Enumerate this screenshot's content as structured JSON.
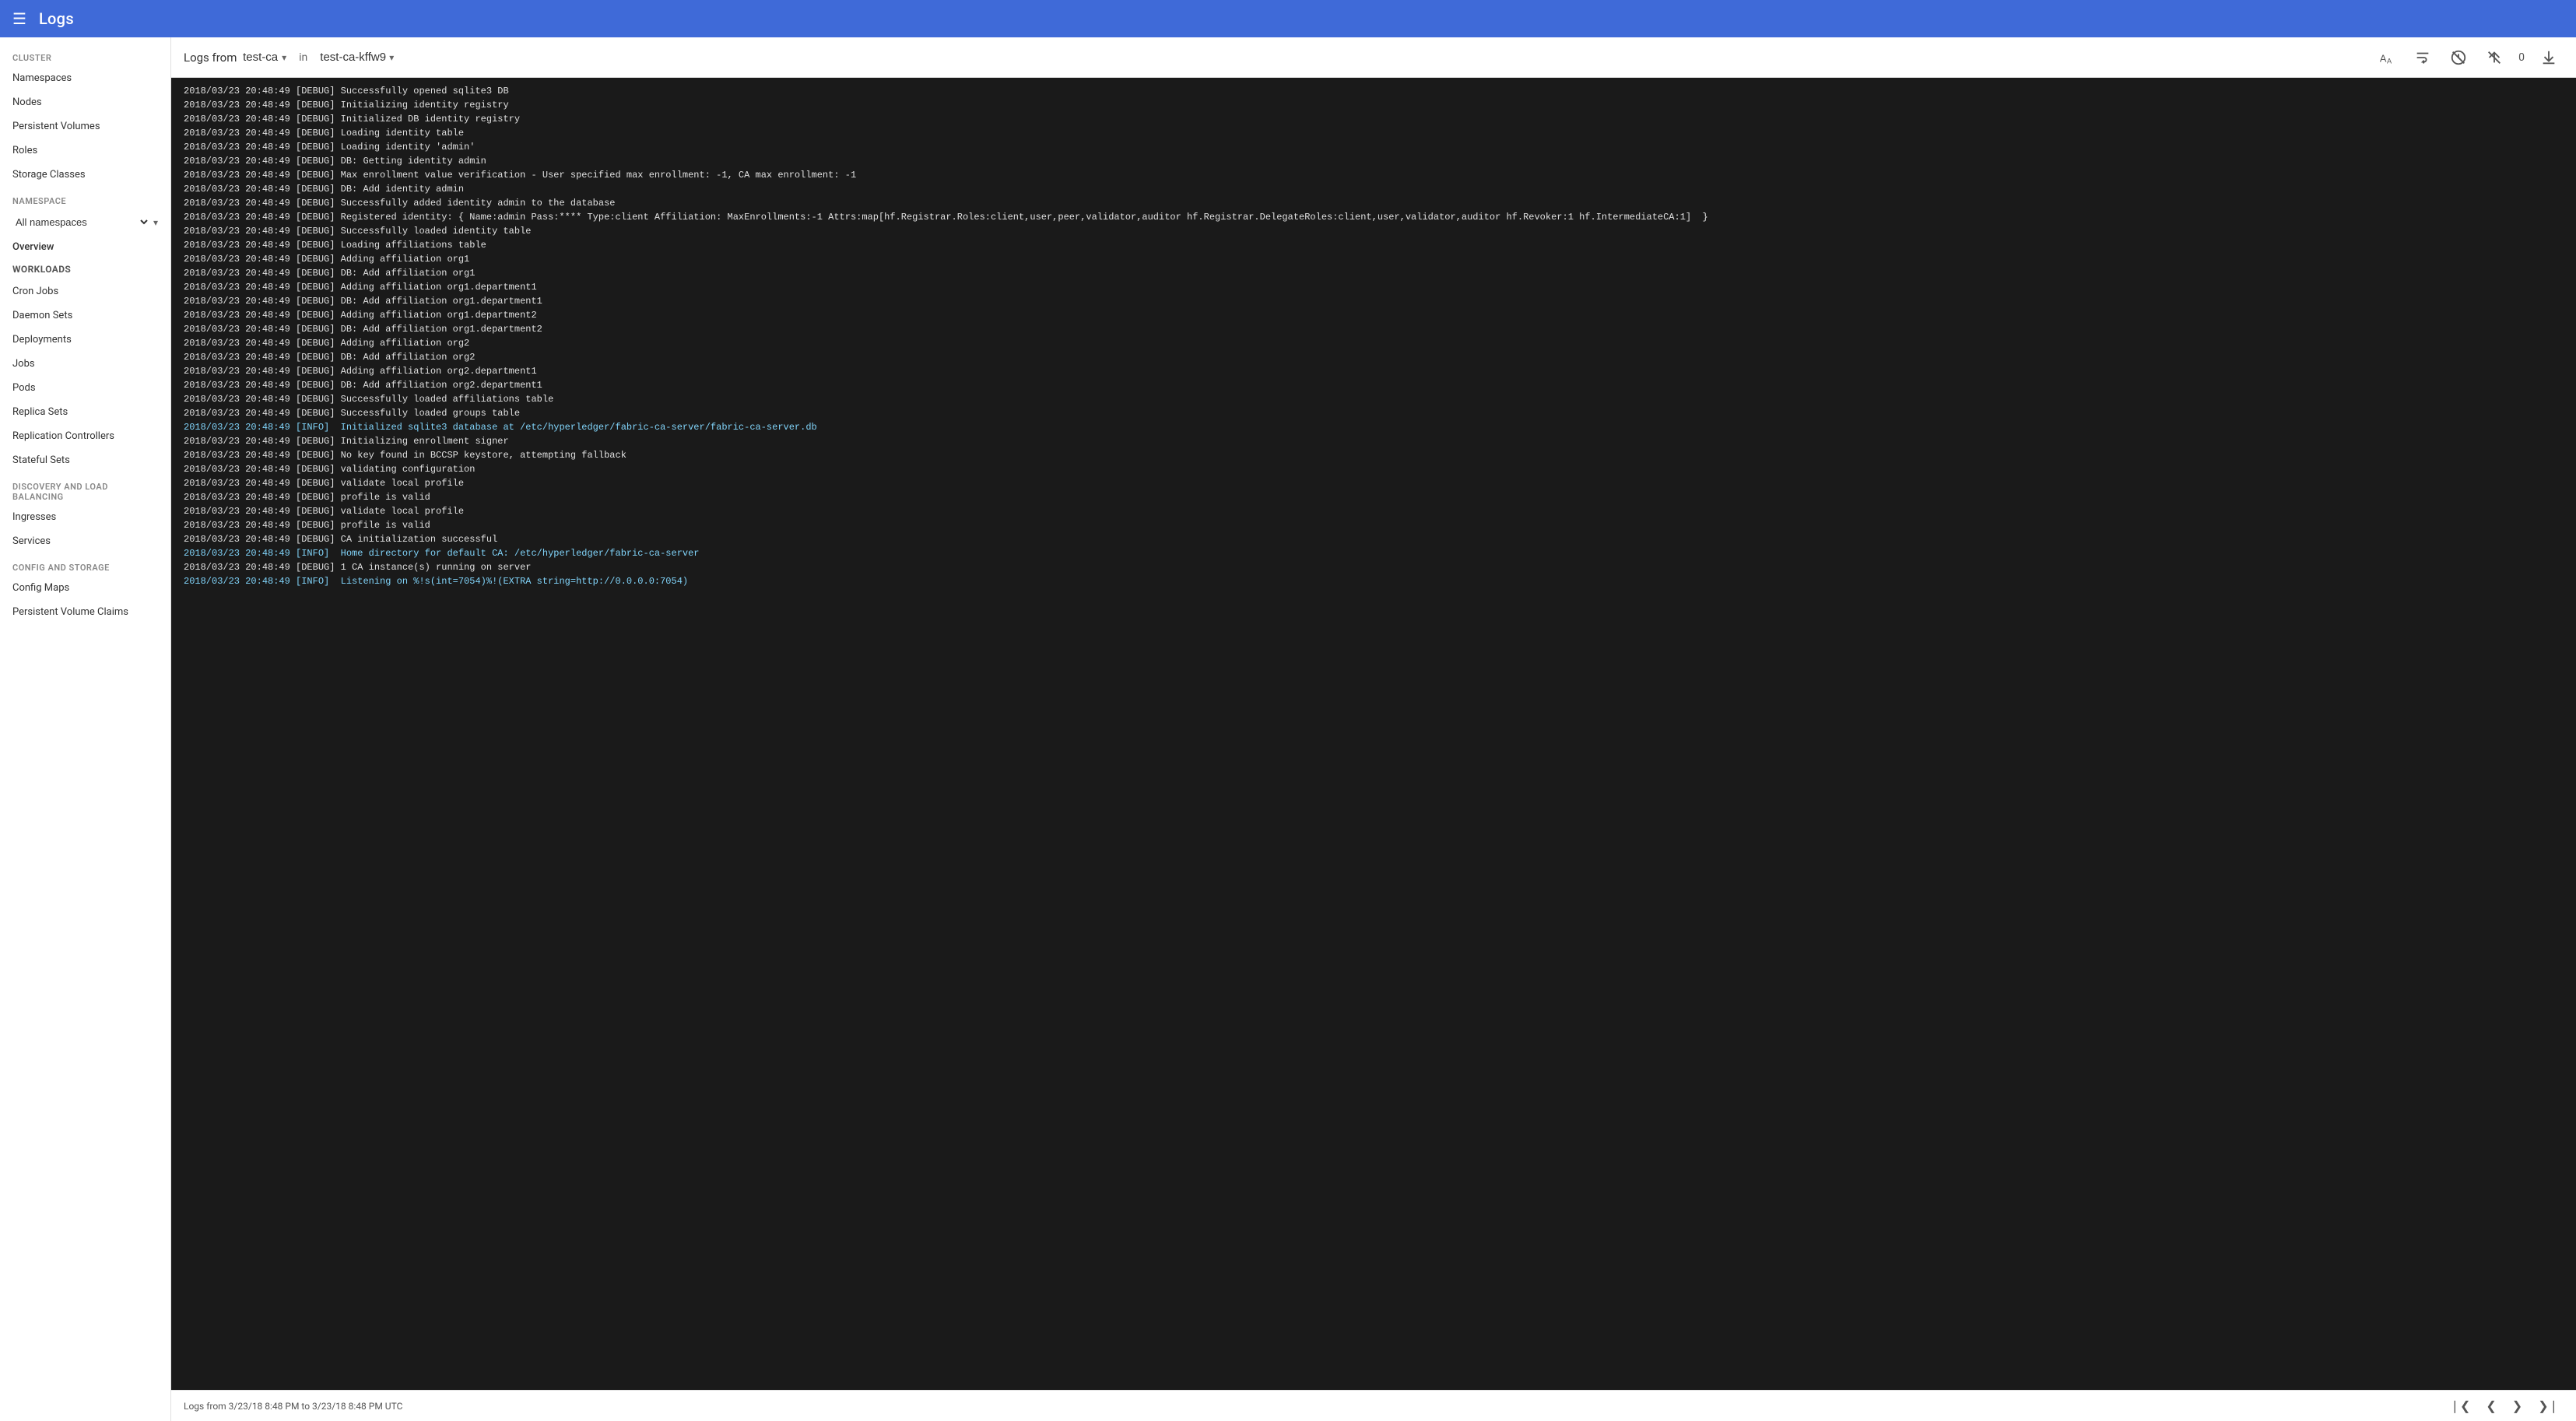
{
  "topbar": {
    "title": "Logs",
    "menu_label": "☰"
  },
  "sidebar": {
    "cluster_label": "Cluster",
    "items_cluster": [
      {
        "label": "Namespaces",
        "id": "namespaces"
      },
      {
        "label": "Nodes",
        "id": "nodes"
      },
      {
        "label": "Persistent Volumes",
        "id": "persistent-volumes"
      },
      {
        "label": "Roles",
        "id": "roles"
      },
      {
        "label": "Storage Classes",
        "id": "storage-classes"
      }
    ],
    "namespace_label": "Namespace",
    "namespace_value": "All namespaces",
    "overview_label": "Overview",
    "workloads_label": "Workloads",
    "items_workloads": [
      {
        "label": "Cron Jobs",
        "id": "cron-jobs"
      },
      {
        "label": "Daemon Sets",
        "id": "daemon-sets"
      },
      {
        "label": "Deployments",
        "id": "deployments"
      },
      {
        "label": "Jobs",
        "id": "jobs"
      },
      {
        "label": "Pods",
        "id": "pods"
      },
      {
        "label": "Replica Sets",
        "id": "replica-sets"
      },
      {
        "label": "Replication Controllers",
        "id": "replication-controllers"
      },
      {
        "label": "Stateful Sets",
        "id": "stateful-sets"
      }
    ],
    "discovery_label": "Discovery and Load Balancing",
    "items_discovery": [
      {
        "label": "Ingresses",
        "id": "ingresses"
      },
      {
        "label": "Services",
        "id": "services"
      }
    ],
    "config_label": "Config and Storage",
    "items_config": [
      {
        "label": "Config Maps",
        "id": "config-maps"
      },
      {
        "label": "Persistent Volume Claims",
        "id": "pvc"
      }
    ]
  },
  "log_viewer": {
    "source_label": "Logs from test-ca",
    "source_dropdown": "test-ca",
    "container_prefix": "in",
    "container_label": "test-ca-kffw9",
    "container_dropdown": "test-ca-kffw9",
    "toolbar_count": "0",
    "footer_range": "Logs from 3/23/18 8:48 PM to 3/23/18 8:48 PM UTC",
    "log_lines": [
      "2018/03/23 20:48:49 [DEBUG] Successfully opened sqlite3 DB",
      "2018/03/23 20:48:49 [DEBUG] Initializing identity registry",
      "2018/03/23 20:48:49 [DEBUG] Initialized DB identity registry",
      "2018/03/23 20:48:49 [DEBUG] Loading identity table",
      "2018/03/23 20:48:49 [DEBUG] Loading identity 'admin'",
      "2018/03/23 20:48:49 [DEBUG] DB: Getting identity admin",
      "2018/03/23 20:48:49 [DEBUG] Max enrollment value verification - User specified max enrollment: -1, CA max enrollment: -1",
      "2018/03/23 20:48:49 [DEBUG] DB: Add identity admin",
      "2018/03/23 20:48:49 [DEBUG] Successfully added identity admin to the database",
      "2018/03/23 20:48:49 [DEBUG] Registered identity: { Name:admin Pass:**** Type:client Affiliation: MaxEnrollments:-1 Attrs:map[hf.Registrar.Roles:client,user,peer,validator,auditor hf.Registrar.DelegateRoles:client,user,validator,auditor hf.Revoker:1 hf.IntermediateCA:1]  }",
      "2018/03/23 20:48:49 [DEBUG] Successfully loaded identity table",
      "2018/03/23 20:48:49 [DEBUG] Loading affiliations table",
      "2018/03/23 20:48:49 [DEBUG] Adding affiliation org1",
      "2018/03/23 20:48:49 [DEBUG] DB: Add affiliation org1",
      "2018/03/23 20:48:49 [DEBUG] Adding affiliation org1.department1",
      "2018/03/23 20:48:49 [DEBUG] DB: Add affiliation org1.department1",
      "2018/03/23 20:48:49 [DEBUG] Adding affiliation org1.department2",
      "2018/03/23 20:48:49 [DEBUG] DB: Add affiliation org1.department2",
      "2018/03/23 20:48:49 [DEBUG] Adding affiliation org2",
      "2018/03/23 20:48:49 [DEBUG] DB: Add affiliation org2",
      "2018/03/23 20:48:49 [DEBUG] Adding affiliation org2.department1",
      "2018/03/23 20:48:49 [DEBUG] DB: Add affiliation org2.department1",
      "2018/03/23 20:48:49 [DEBUG] Successfully loaded affiliations table",
      "2018/03/23 20:48:49 [DEBUG] Successfully loaded groups table",
      "2018/03/23 20:48:49 [INFO]  Initialized sqlite3 database at /etc/hyperledger/fabric-ca-server/fabric-ca-server.db",
      "2018/03/23 20:48:49 [DEBUG] Initializing enrollment signer",
      "2018/03/23 20:48:49 [DEBUG] No key found in BCCSP keystore, attempting fallback",
      "2018/03/23 20:48:49 [DEBUG] validating configuration",
      "2018/03/23 20:48:49 [DEBUG] validate local profile",
      "2018/03/23 20:48:49 [DEBUG] profile is valid",
      "2018/03/23 20:48:49 [DEBUG] validate local profile",
      "2018/03/23 20:48:49 [DEBUG] profile is valid",
      "2018/03/23 20:48:49 [DEBUG] CA initialization successful",
      "2018/03/23 20:48:49 [INFO]  Home directory for default CA: /etc/hyperledger/fabric-ca-server",
      "2018/03/23 20:48:49 [DEBUG] 1 CA instance(s) running on server",
      "2018/03/23 20:48:49 [INFO]  Listening on %!s(int=7054)%!(EXTRA string=http://0.0.0.0:7054)"
    ]
  }
}
